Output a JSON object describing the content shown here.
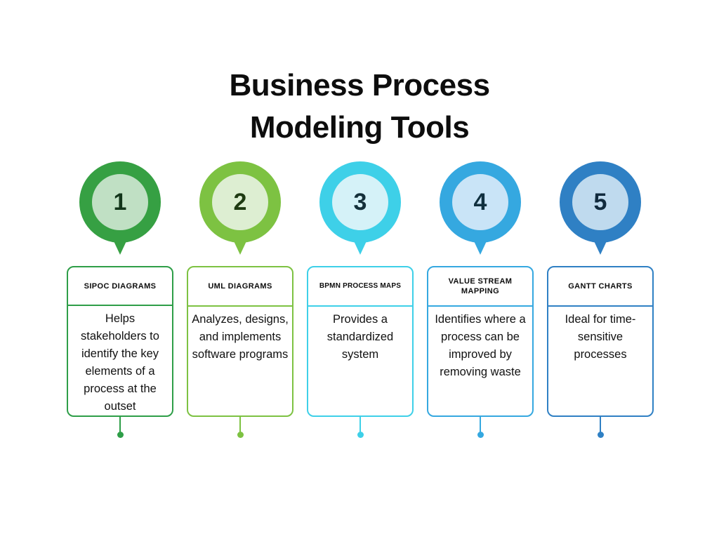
{
  "title": {
    "line1": "Business Process",
    "line2": "Modeling Tools"
  },
  "steps": [
    {
      "number": "1",
      "header": "SIPOC DIAGRAMS",
      "body": "Helps stakeholders to identify the key elements of a process at the outset",
      "ring_color": "#36A043",
      "fill_color": "#C0E0C4",
      "number_color": "#12351A",
      "card_color": "#2E9E48",
      "accent_color": "#2E9E48"
    },
    {
      "number": "2",
      "header": "UML DIAGRAMS",
      "body": "Analyzes, designs, and implements software programs",
      "ring_color": "#7DC242",
      "fill_color": "#DDEED2",
      "number_color": "#1E3A12",
      "card_color": "#7DC242",
      "accent_color": "#7DC242"
    },
    {
      "number": "3",
      "header": "BPMN PROCESS MAPS",
      "body": "Provides a standardized system",
      "ring_color": "#3ED0E8",
      "fill_color": "#D5F2F8",
      "number_color": "#14303A",
      "card_color": "#3ED0E8",
      "accent_color": "#3ED0E8"
    },
    {
      "number": "4",
      "header": "VALUE STREAM MAPPING",
      "body": "Identifies where a process can be improved by removing waste",
      "ring_color": "#35A8E0",
      "fill_color": "#C9E4F7",
      "number_color": "#10303F",
      "card_color": "#35A8E0",
      "accent_color": "#35A8E0"
    },
    {
      "number": "5",
      "header": "GANTT CHARTS",
      "body": "Ideal for time-sensitive processes",
      "ring_color": "#2F80C4",
      "fill_color": "#BFDAEE",
      "number_color": "#112A3D",
      "card_color": "#2F80C4",
      "accent_color": "#2F80C4"
    }
  ]
}
